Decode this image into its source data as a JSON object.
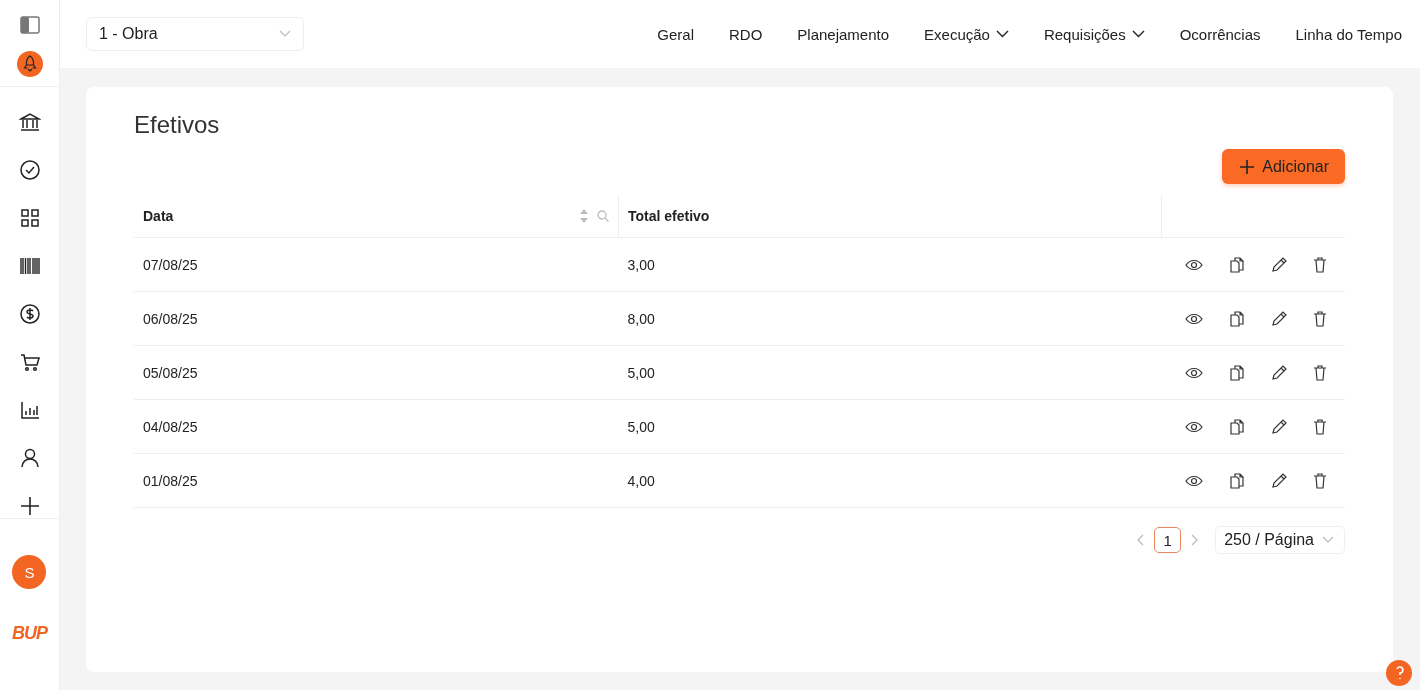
{
  "sidebar": {
    "avatar": "S",
    "logo": "BUP"
  },
  "header": {
    "project_select": {
      "value": "1 - Obra"
    },
    "nav": [
      {
        "label": "Geral",
        "dropdown": false
      },
      {
        "label": "RDO",
        "dropdown": false
      },
      {
        "label": "Planejamento",
        "dropdown": false
      },
      {
        "label": "Execução",
        "dropdown": true
      },
      {
        "label": "Requisições",
        "dropdown": true
      },
      {
        "label": "Ocorrências",
        "dropdown": false
      },
      {
        "label": "Linha do Tempo",
        "dropdown": false
      }
    ]
  },
  "page": {
    "title": "Efetivos",
    "add_button": "Adicionar"
  },
  "table": {
    "columns": [
      "Data",
      "Total efetivo"
    ],
    "rows": [
      {
        "data": "07/08/25",
        "total": "3,00"
      },
      {
        "data": "06/08/25",
        "total": "8,00"
      },
      {
        "data": "05/08/25",
        "total": "5,00"
      },
      {
        "data": "04/08/25",
        "total": "5,00"
      },
      {
        "data": "01/08/25",
        "total": "4,00"
      }
    ]
  },
  "pagination": {
    "pages": [
      {
        "label": "1",
        "selected": true
      }
    ],
    "page_size": "250 / Página"
  }
}
